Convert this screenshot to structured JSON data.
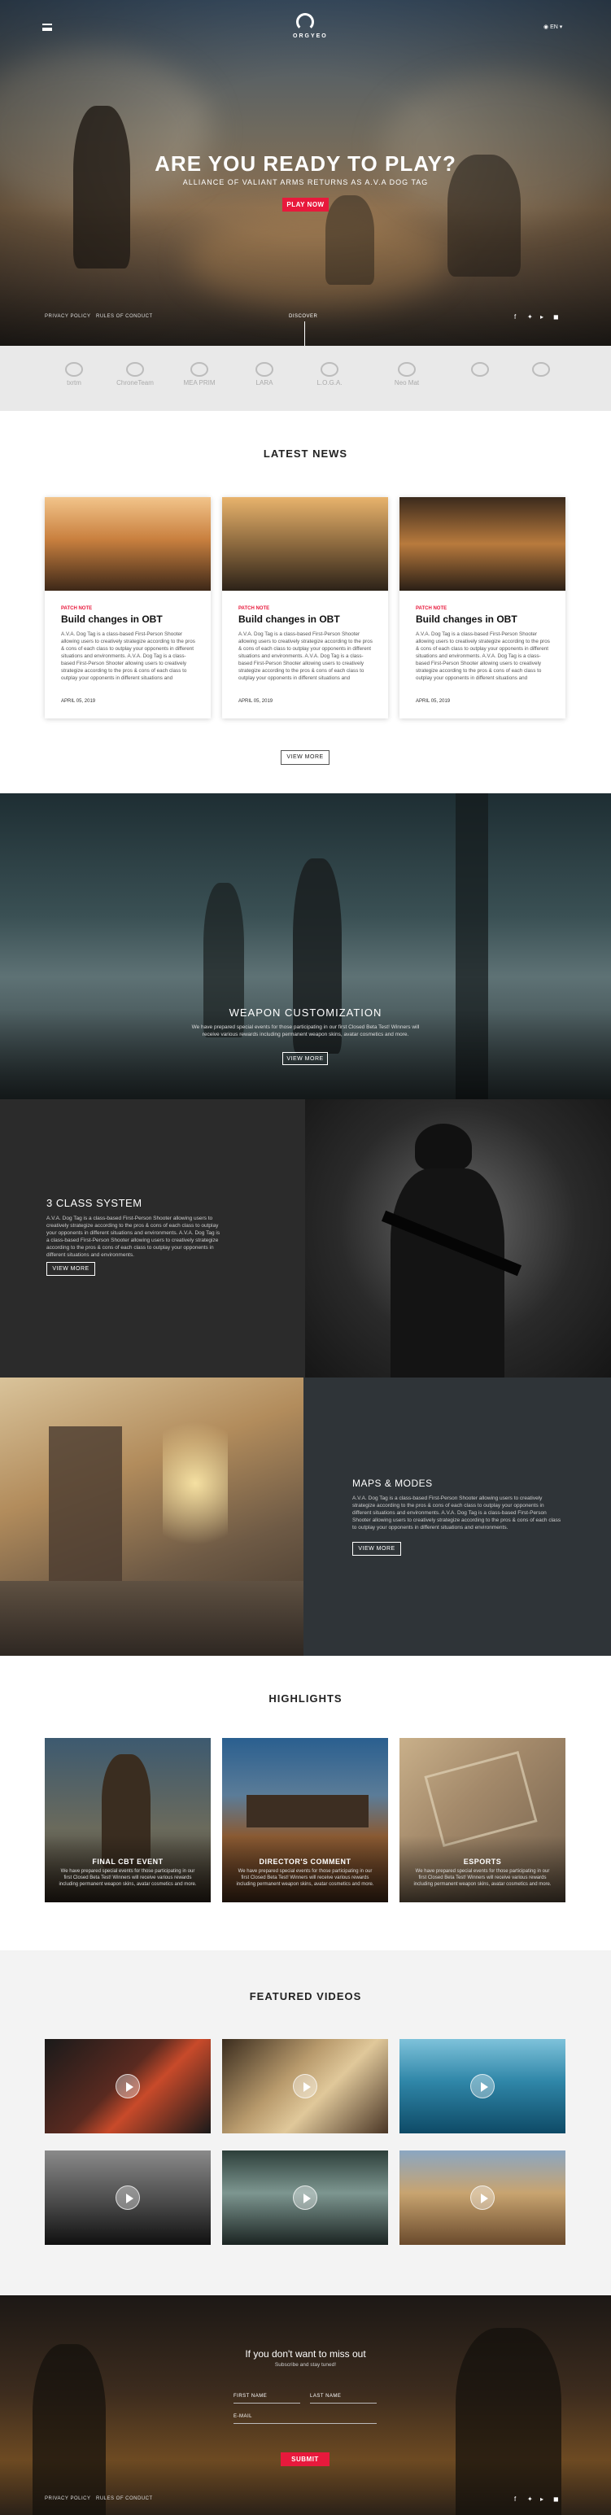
{
  "header": {
    "logo_text": "ORGYEO",
    "lang": "EN ▾",
    "menu_icon": "menu-icon"
  },
  "hero": {
    "title": "ARE YOU READY TO PLAY?",
    "subtitle": "ALLIANCE OF VALIANT ARMS RETURNS AS A.V.A DOG TAG",
    "cta": "PLAY NOW",
    "footer_links": [
      "PRIVACY POLICY",
      "RULES OF CONDUCT"
    ],
    "discover": "DISCOVER",
    "social_icons": [
      "facebook-icon",
      "twitter-icon",
      "youtube-icon",
      "twitch-icon"
    ]
  },
  "partners": [
    "txrtm",
    "ChroneTeam",
    "MEA PRIM",
    "LARA",
    "L.O.G.A.",
    "Neo Mat"
  ],
  "news": {
    "title": "LATEST NEWS",
    "cards": [
      {
        "tag": "PATCH NOTE",
        "title": "Build changes in OBT",
        "text": "A.V.A. Dog Tag is a class-based First-Person Shooter allowing users to creatively strategize according to the pros & cons of each class to outplay your opponents in different situations and environments. A.V.A. Dog Tag is a class-based First-Person Shooter allowing users to creatively strategize according to the pros & cons of each class to outplay your opponents in different situations and",
        "date": "APRIL 05, 2019"
      },
      {
        "tag": "PATCH NOTE",
        "title": "Build changes in OBT",
        "text": "A.V.A. Dog Tag is a class-based First-Person Shooter allowing users to creatively strategize according to the pros & cons of each class to outplay your opponents in different situations and environments. A.V.A. Dog Tag is a class-based First-Person Shooter allowing users to creatively strategize according to the pros & cons of each class to outplay your opponents in different situations and",
        "date": "APRIL 05, 2019"
      },
      {
        "tag": "PATCH NOTE",
        "title": "Build changes in OBT",
        "text": "A.V.A. Dog Tag is a class-based First-Person Shooter allowing users to creatively strategize according to the pros & cons of each class to outplay your opponents in different situations and environments. A.V.A. Dog Tag is a class-based First-Person Shooter allowing users to creatively strategize according to the pros & cons of each class to outplay your opponents in different situations and",
        "date": "APRIL 05, 2019"
      }
    ],
    "view_more": "VIEW MORE"
  },
  "weapon": {
    "title": "WEAPON CUSTOMIZATION",
    "text": "We have prepared special events for those participating in our first Closed Beta Test! Winners will receive various rewards including permanent weapon skins, avatar cosmetics and more.",
    "button": "VIEW MORE"
  },
  "class_system": {
    "title": "3 CLASS SYSTEM",
    "text": "A.V.A. Dog Tag is a class-based First-Person Shooter allowing users to creatively strategize according to the pros & cons of each class to outplay your opponents in different situations and environments. A.V.A. Dog Tag is a class-based First-Person Shooter allowing users to creatively strategize according to the pros & cons of each class to outplay your opponents in different situations and environments.",
    "button": "VIEW MORE"
  },
  "maps": {
    "title": "MAPS & MODES",
    "text": "A.V.A. Dog Tag is a class-based First-Person Shooter allowing users to creatively strategize according to the pros & cons of each class to outplay your opponents in different situations and environments. A.V.A. Dog Tag is a class-based First-Person Shooter allowing users to creatively strategize according to the pros & cons of each class to outplay your opponents in different situations and environments.",
    "button": "VIEW MORE"
  },
  "highlights": {
    "title": "HIGHLIGHTS",
    "cards": [
      {
        "caption": "FINAL CBT EVENT",
        "text": "We have prepared special events for those participating in our first Closed Beta Test! Winners will receive various rewards including permanent weapon skins, avatar cosmetics and more."
      },
      {
        "caption": "DIRECTOR'S COMMENT",
        "text": "We have prepared special events for those participating in our first Closed Beta Test! Winners will receive various rewards including permanent weapon skins, avatar cosmetics and more."
      },
      {
        "caption": "ESPORTS",
        "text": "We have prepared special events for those participating in our first Closed Beta Test! Winners will receive various rewards including permanent weapon skins, avatar cosmetics and more."
      }
    ]
  },
  "videos": {
    "title": "FEATURED VIDEOS"
  },
  "subscribe": {
    "title": "If you don't want to miss out",
    "subtitle": "Subscribe and stay tuned!",
    "first_name": "FIRST NAME",
    "last_name": "LAST NAME",
    "email": "E-MAIL",
    "submit": "SUBMIT"
  },
  "footer": {
    "links": [
      "PRIVACY POLICY",
      "RULES OF CONDUCT"
    ]
  },
  "colors": {
    "accent": "#e8193c"
  }
}
